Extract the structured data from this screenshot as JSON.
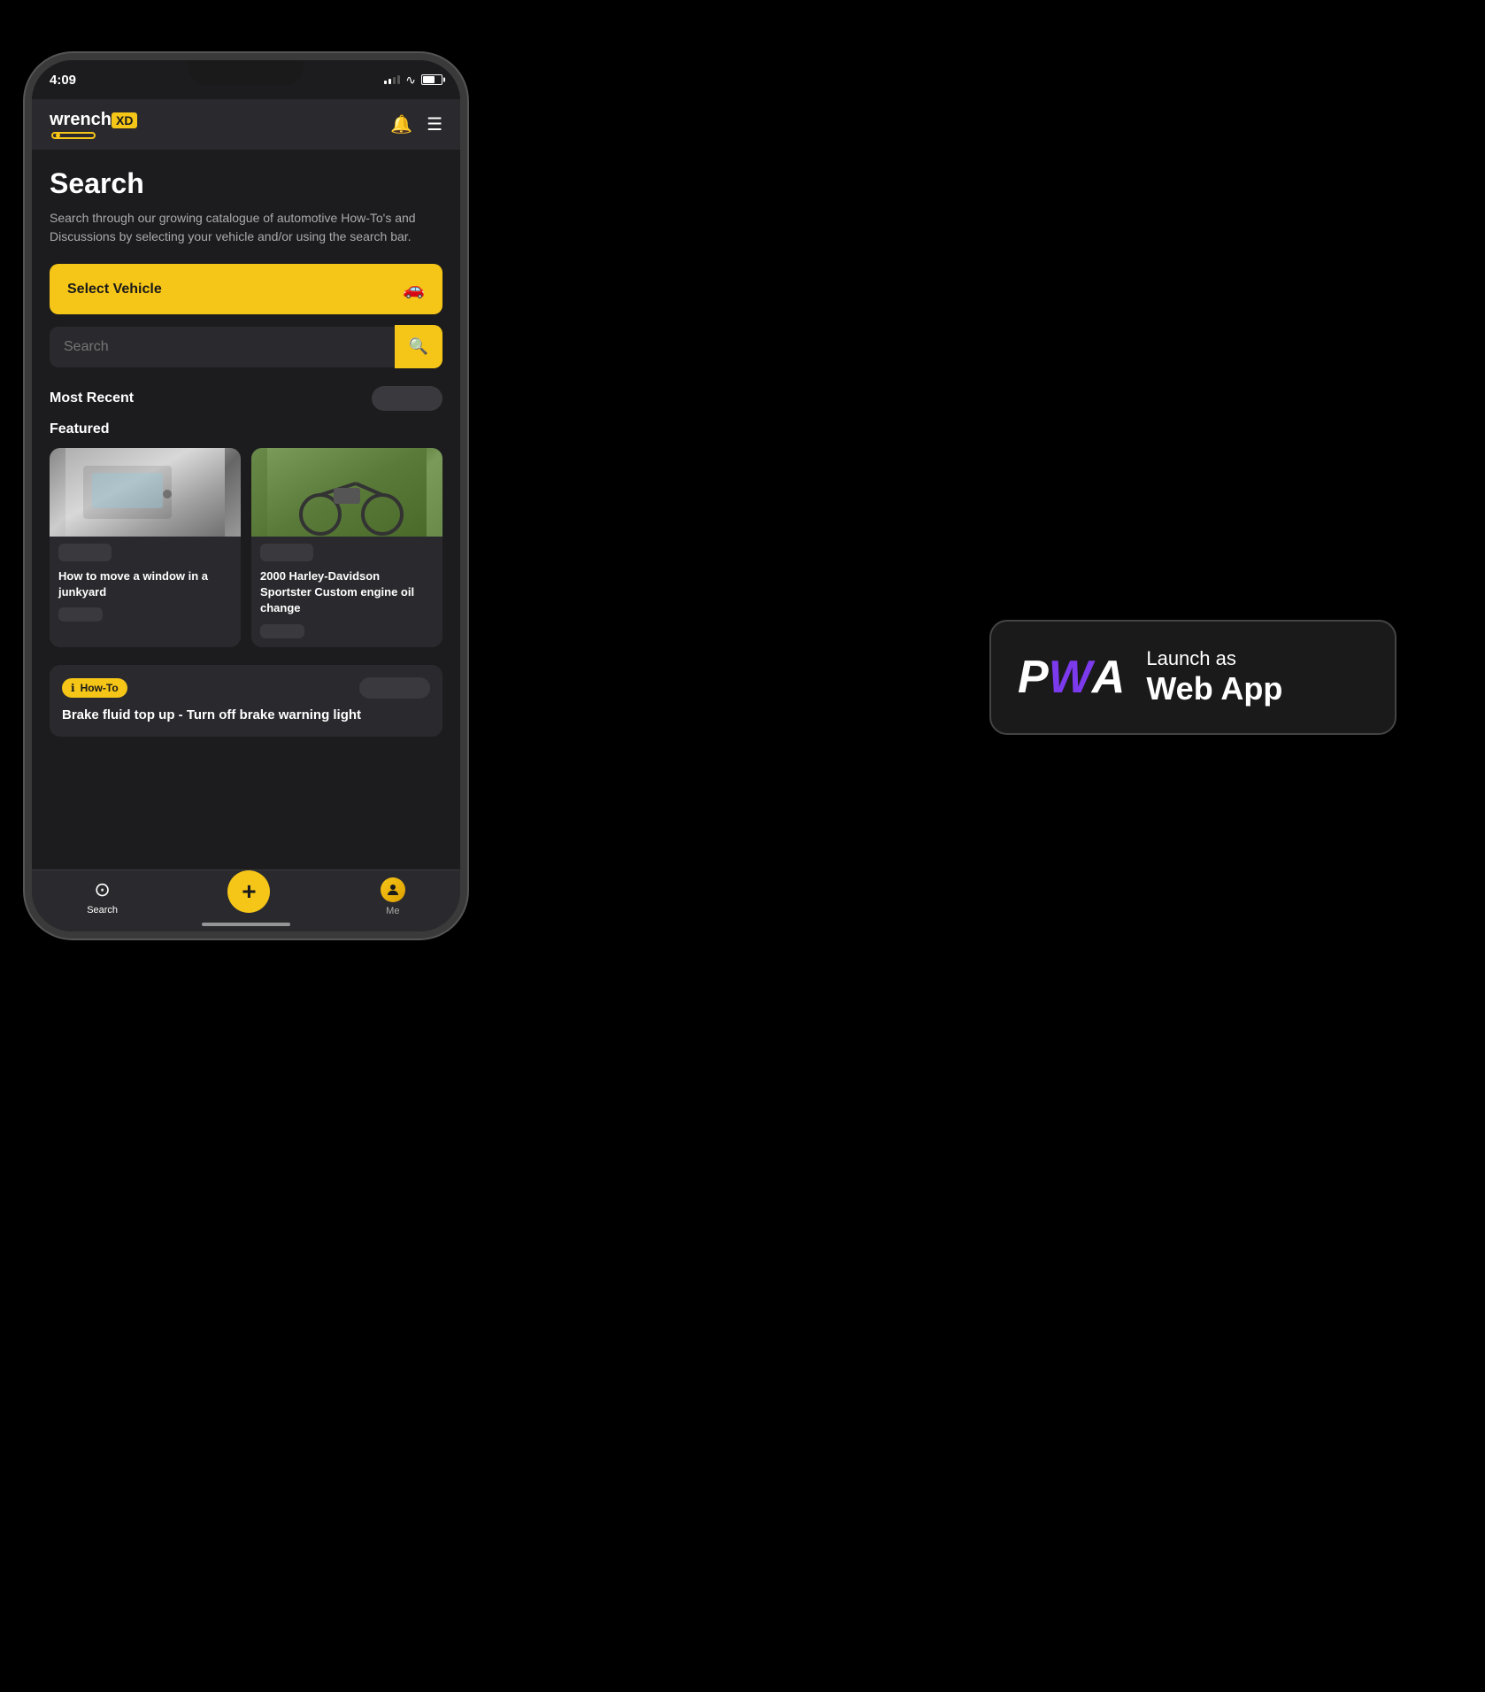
{
  "status_bar": {
    "time": "4:09",
    "battery_level": 65
  },
  "app": {
    "logo": {
      "text_wrench": "wrench",
      "text_xd": "XD"
    },
    "header": {
      "notification_icon": "bell-icon",
      "menu_icon": "menu-icon"
    },
    "page": {
      "title": "Search",
      "description": "Search through our growing catalogue of automotive How-To's and Discussions by selecting your vehicle and/or using the search bar."
    },
    "select_vehicle": {
      "label": "Select Vehicle",
      "icon": "car-icon"
    },
    "search": {
      "placeholder": "Search",
      "button_icon": "search-icon"
    },
    "sections": {
      "most_recent": {
        "label": "Most Recent"
      },
      "featured": {
        "label": "Featured"
      }
    },
    "cards": [
      {
        "tag_color": "#3a3a3e",
        "title": "How to move a window in a junkyard",
        "image_type": "car-window"
      },
      {
        "tag_color": "#3a3a3e",
        "title": "2000 Harley-Davidson Sportster Custom engine oil change",
        "image_type": "motorcycle"
      }
    ],
    "list_items": [
      {
        "badge_text": "How-To",
        "badge_icon": "info-icon",
        "title": "Brake fluid top up - Turn off brake warning light"
      }
    ],
    "tab_bar": {
      "tabs": [
        {
          "id": "search",
          "label": "Search",
          "icon": "compass-icon",
          "active": true
        },
        {
          "id": "add",
          "label": "",
          "icon": "plus-icon",
          "active": false,
          "center": true
        },
        {
          "id": "me",
          "label": "Me",
          "icon": "avatar-icon",
          "active": false
        }
      ]
    }
  },
  "pwa_button": {
    "launch_as": "Launch as",
    "web_app": "Web App",
    "logo_p": "P",
    "logo_w": "W",
    "logo_a": "A"
  }
}
